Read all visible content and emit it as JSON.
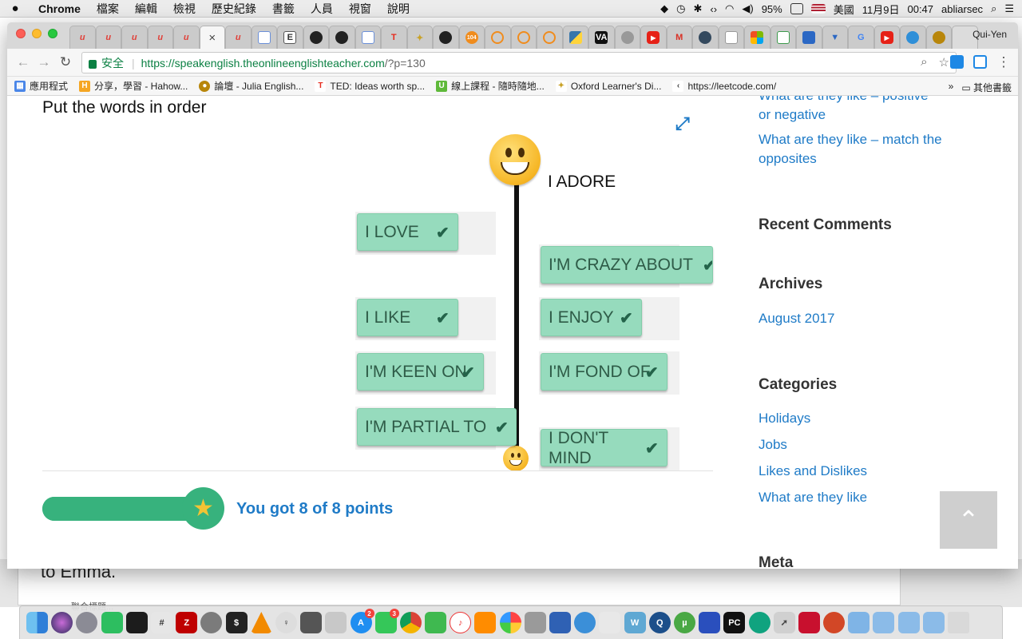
{
  "menubar": {
    "apple": "",
    "items": [
      "Chrome",
      "檔案",
      "編輯",
      "檢視",
      "歷史紀錄",
      "書籤",
      "人員",
      "視窗",
      "說明"
    ],
    "battery": "95%",
    "input_source": "美國",
    "date": "11月9日",
    "time": "00:47",
    "user": "abliarsec"
  },
  "browser": {
    "profile_name": "Qui-Yen",
    "active_tab_close": "×",
    "omnibox": {
      "secure_label": "安全",
      "url_main": "https://speakenglish.theonlineenglishteacher.com",
      "url_rest": "/?p=130"
    },
    "bookmarks": [
      {
        "label": "應用程式",
        "icon": "apps-icon",
        "color": "#4a86e8",
        "glyph": "▦"
      },
      {
        "label": "分享，學習 - Hahow...",
        "icon": "hahow-icon",
        "color": "#f5a623",
        "glyph": "H"
      },
      {
        "label": "論壇 - Julia English...",
        "icon": "julia-icon",
        "color": "#b8860b",
        "glyph": "●"
      },
      {
        "label": "TED: Ideas worth sp...",
        "icon": "ted-icon",
        "color": "#e62b1e",
        "glyph": "T"
      },
      {
        "label": "線上課程 - 隨時隨地...",
        "icon": "udemy-icon",
        "color": "#5fb93a",
        "glyph": "U"
      },
      {
        "label": "Oxford Learner's Di...",
        "icon": "oxford-icon",
        "color": "#c9a227",
        "glyph": "✦"
      },
      {
        "label": "https://leetcode.com/",
        "icon": "leetcode-icon",
        "color": "#444444",
        "glyph": "‹"
      }
    ],
    "bookmarks_overflow": "»",
    "bookmarks_other": "其他書籤"
  },
  "quiz": {
    "title": "Put the words in order",
    "top_label": "I ADORE",
    "cards": {
      "i_love": "I LOVE",
      "i_like": "I LIKE",
      "im_keen_on": "I'M KEEN ON",
      "im_partial_to": "I'M PARTIAL TO",
      "im_crazy_about": "I'M CRAZY ABOUT",
      "i_enjoy": "I ENJOY",
      "im_fond_of": "I'M FOND OF",
      "i_dont_mind": "I DON'T MIND"
    },
    "check_glyph": "✔",
    "score_text": "You got 8 of 8 points",
    "score_obtained": 8,
    "score_total": 8,
    "progress_fraction": 1.0
  },
  "sidebar": {
    "links_top": [
      "What are they like – positive or negative",
      "What are they like – match the opposites"
    ],
    "recent_comments_heading": "Recent Comments",
    "archives_heading": "Archives",
    "archives": [
      "August 2017"
    ],
    "categories_heading": "Categories",
    "categories": [
      "Holidays",
      "Jobs",
      "Likes and Dislikes",
      "What are they like"
    ],
    "meta_heading": "Meta",
    "scroll_top_glyph": "⌃"
  },
  "background_doc": {
    "text": "to Emma.",
    "subtext": "聯合標題..."
  },
  "colors": {
    "card_bg": "#96dbbd",
    "card_text": "#2e5b47",
    "link": "#1f7bc7",
    "progress": "#37b27d",
    "secure_green": "#0b8043"
  }
}
